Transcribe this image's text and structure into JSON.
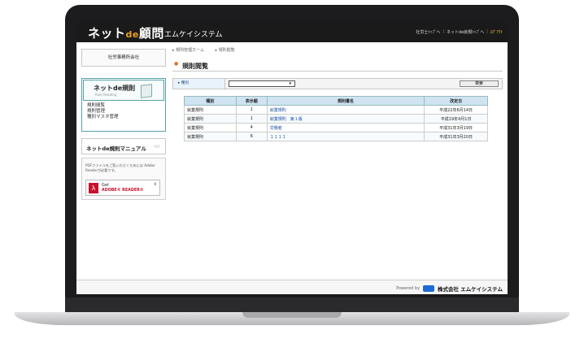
{
  "header": {
    "logo_main": "ネット",
    "logo_de": "de",
    "logo_tail": "顧問",
    "company": "エムケイシステム",
    "links": [
      "社労士ﾄｯﾌﾟへ",
      "ネットde就規ﾄｯﾌﾟへ"
    ],
    "logout": "ﾛｸﾞｱｳﾄ"
  },
  "sidebar": {
    "client": "社労事務所会社",
    "rule_title": "ネットde規則",
    "rule_sub": "Rule Reading",
    "menu": [
      "規則閲覧",
      "規則管理",
      "種別マスタ管理"
    ],
    "manual": "ネットde規則マニュアル",
    "pdf_tag": "PDF",
    "adobe_note": "PDFファイルをご覧いただくためには Adobe Readerが必要です。",
    "adobe_get": "Get",
    "adobe_reader": "ADOBE® READER®"
  },
  "main": {
    "breadcrumb": [
      "規則管理ホーム",
      "規則閲覧"
    ],
    "page_title": "規則閲覧",
    "filter_label": "種別",
    "filter_value": "",
    "search_button": "検索",
    "columns": [
      "種別",
      "表示順",
      "規則書名",
      "改定日"
    ],
    "rows": [
      [
        "就業規則",
        "1",
        "就業規則",
        "平成22年6月14日"
      ],
      [
        "就業規則",
        "1",
        "就業規則　第１版",
        "平成19年4月1日"
      ],
      [
        "就業規則",
        "4",
        "労働者",
        "平成31年3月19日"
      ],
      [
        "就業規則",
        "6",
        "１１１１",
        "平成31年3月20日"
      ]
    ]
  },
  "footer": {
    "powered": "Powered by",
    "brand": "株式会社 エムケイシステム"
  }
}
